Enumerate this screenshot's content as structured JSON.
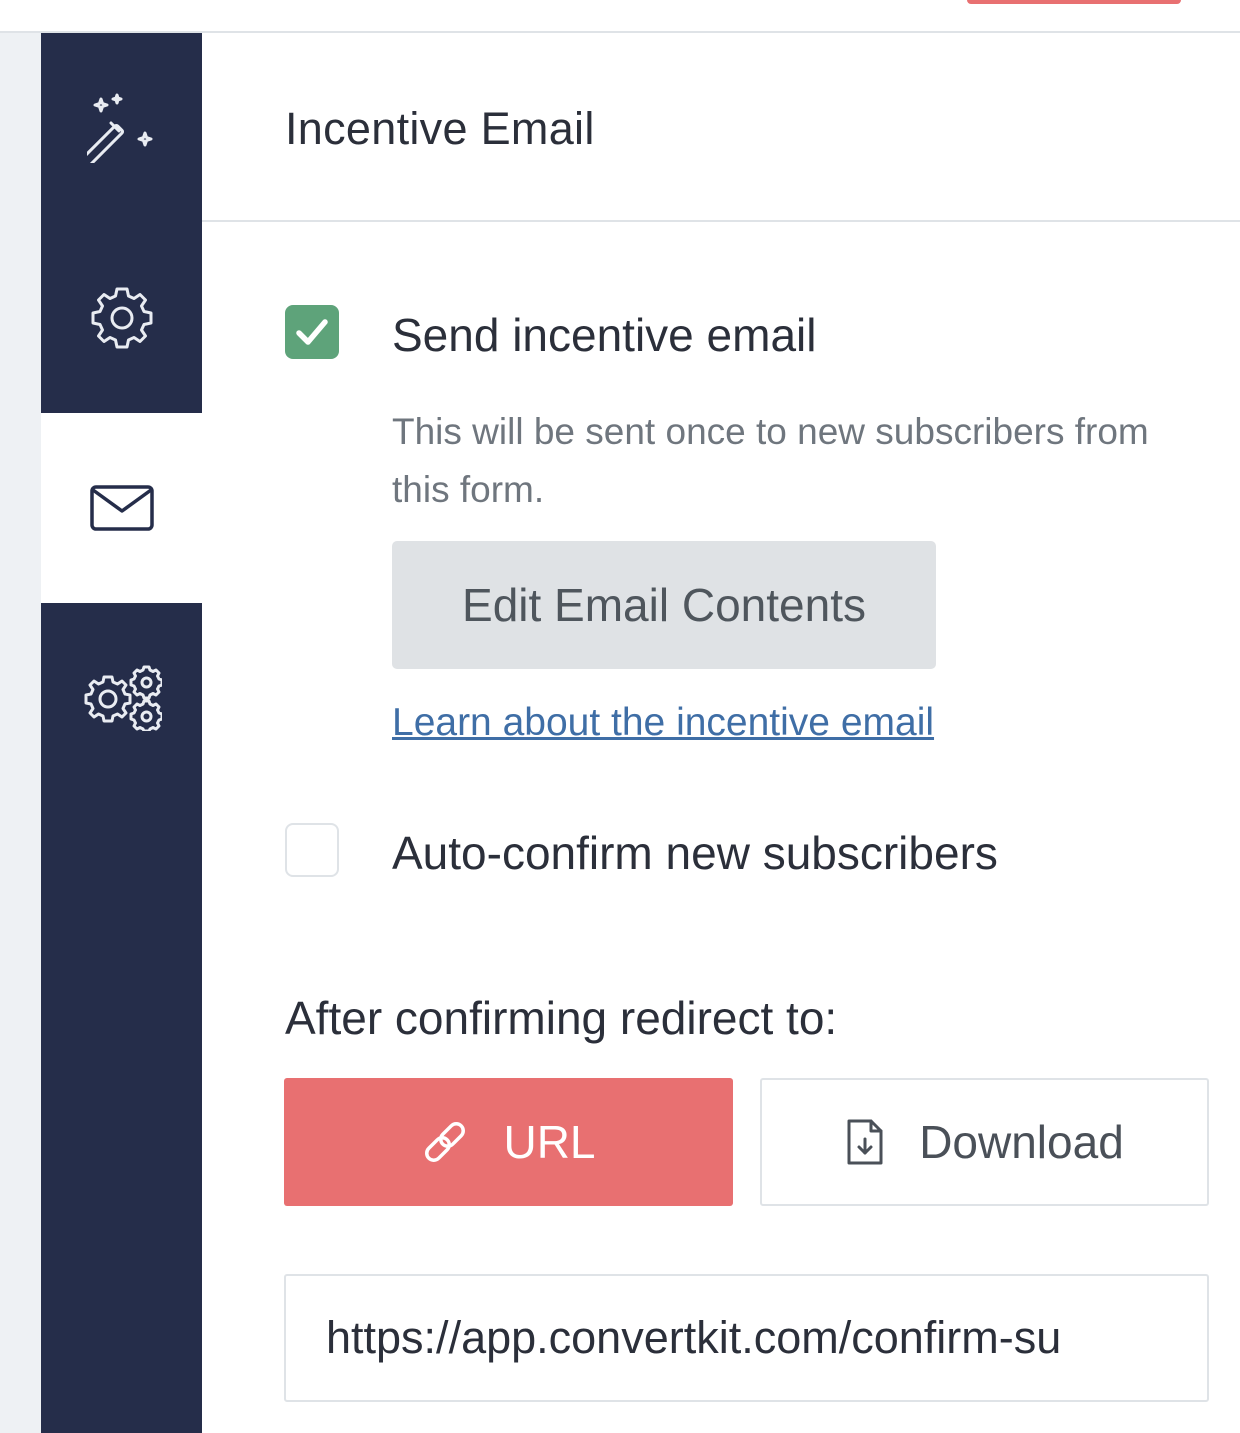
{
  "colors": {
    "sidebar_bg": "#252d4a",
    "accent": "#e87071",
    "checkbox_checked": "#5ea37a",
    "link": "#3f6ea6"
  },
  "sidebar": {
    "items": [
      {
        "icon": "magic-wand-icon",
        "active": false
      },
      {
        "icon": "gear-icon",
        "active": false
      },
      {
        "icon": "envelope-icon",
        "active": true
      },
      {
        "icon": "multi-gear-icon",
        "active": false
      }
    ]
  },
  "panel": {
    "title": "Incentive Email",
    "send_incentive": {
      "label": "Send incentive email",
      "checked": true,
      "help": "This will be sent once to new subscribers from this form."
    },
    "edit_button": "Edit Email Contents",
    "learn_link": "Learn about the incentive email",
    "auto_confirm": {
      "label": "Auto-confirm new subscribers",
      "checked": false
    },
    "redirect": {
      "label": "After confirming redirect to:",
      "options": [
        {
          "label": "URL",
          "icon": "link-icon",
          "selected": true
        },
        {
          "label": "Download",
          "icon": "file-download-icon",
          "selected": false
        }
      ],
      "url_value": "https://app.convertkit.com/confirm-su"
    }
  }
}
